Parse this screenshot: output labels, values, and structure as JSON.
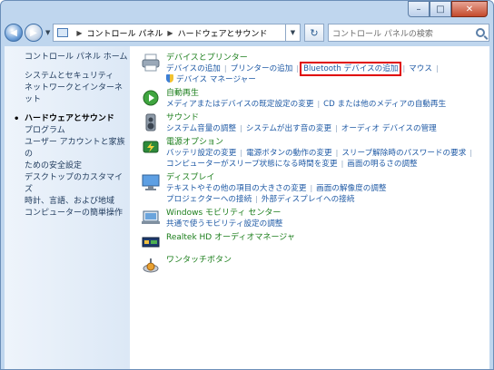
{
  "window": {
    "caption": {
      "minimize": "–",
      "maximize": "□",
      "close": "✕"
    }
  },
  "navigation": {
    "back_icon": "◀",
    "forward_icon": "▶",
    "dropdown_icon": "▼",
    "breadcrumb": [
      "コントロール パネル",
      "ハードウェアとサウンド"
    ],
    "separator": "▶",
    "refresh_icon": "↻",
    "search_placeholder": "コントロール パネルの検索"
  },
  "sidebar": {
    "items": [
      {
        "label": "コントロール パネル ホーム"
      },
      {
        "label": "システムとセキュリティ"
      },
      {
        "label": "ネットワークとインターネット"
      },
      {
        "label": "ハードウェアとサウンド",
        "current": true
      },
      {
        "label": "プログラム"
      },
      {
        "label": "ユーザー アカウントと家族の"
      },
      {
        "label": "ための安全設定"
      },
      {
        "label": "デスクトップのカスタマイズ"
      },
      {
        "label": "時計、言語、および地域"
      },
      {
        "label": "コンピューターの簡単操作"
      }
    ]
  },
  "categories": [
    {
      "title": "デバイスとプリンター",
      "icon": "printer-icon",
      "links": [
        [
          "デバイスの追加",
          "プリンターの追加",
          "Bluetooth デバイスの追加",
          "マウス"
        ],
        [
          "デバイス マネージャー"
        ]
      ]
    },
    {
      "title": "自動再生",
      "icon": "autoplay-icon",
      "links": [
        [
          "メディアまたはデバイスの既定設定の変更",
          "CD または他のメディアの自動再生"
        ]
      ]
    },
    {
      "title": "サウンド",
      "icon": "speaker-icon",
      "links": [
        [
          "システム音量の調整",
          "システムが出す音の変更",
          "オーディオ デバイスの管理"
        ]
      ]
    },
    {
      "title": "電源オプション",
      "icon": "power-options-icon",
      "links": [
        [
          "バッテリ設定の変更",
          "電源ボタンの動作の変更",
          "スリープ解除時のパスワードの要求"
        ],
        [
          "コンピューターがスリープ状態になる時間を変更",
          "画面の明るさの調整"
        ]
      ]
    },
    {
      "title": "ディスプレイ",
      "icon": "display-icon",
      "links": [
        [
          "テキストやその他の項目の大きさの変更",
          "画面の解像度の調整"
        ],
        [
          "プロジェクターへの接続",
          "外部ディスプレイへの接続"
        ]
      ]
    },
    {
      "title": "Windows モビリティ センター",
      "icon": "mobility-center-icon",
      "links": [
        [
          "共通で使うモビリティ設定の調整"
        ]
      ]
    },
    {
      "title": "Realtek HD オーディオマネージャ",
      "icon": "realtek-audio-icon",
      "links": []
    },
    {
      "title": "ワンタッチボタン",
      "icon": "one-touch-button-icon",
      "links": []
    }
  ],
  "colors": {
    "highlight_outline": "#e00000",
    "category_title": "#1a7d1a",
    "link": "#1f5aa5"
  }
}
